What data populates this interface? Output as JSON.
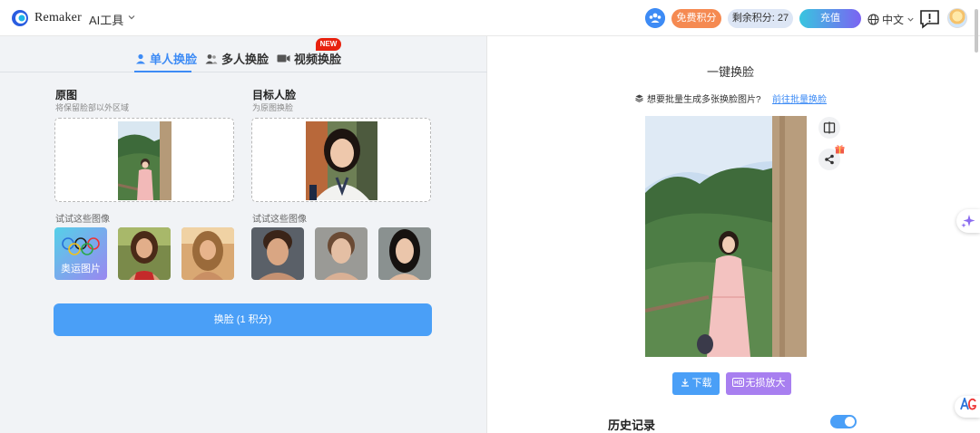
{
  "header": {
    "brand": "Remaker",
    "ai_tools": "AI工具",
    "free_credits": "免费积分",
    "remaining": "剩余积分: 27",
    "recharge": "充值",
    "language": "中文"
  },
  "tabs": [
    {
      "label": "单人换脸",
      "active": true
    },
    {
      "label": "多人换脸",
      "active": false
    },
    {
      "label": "视频换脸",
      "active": false,
      "badge": "NEW"
    }
  ],
  "source": {
    "title": "原图",
    "subtitle": "将保留脸部以外区域",
    "try_label": "试试这些图像",
    "thumb_olympics": "奥运图片"
  },
  "target": {
    "title": "目标人脸",
    "subtitle": "为原图换脸",
    "try_label": "试试这些图像"
  },
  "swap_button": "换脸 (1 积分)",
  "result": {
    "title": "一键换脸",
    "batch_question": "想要批量生成多张换脸图片?",
    "batch_link": "前往批量换脸",
    "download": "下载",
    "upscale": "无损放大"
  },
  "history": {
    "label": "历史记录",
    "toggle_on": true
  },
  "colors": {
    "accent": "#3d8bf5",
    "free_badge": "#f58a52",
    "upscale": "#a87ff0",
    "new_badge": "#e8220f"
  }
}
